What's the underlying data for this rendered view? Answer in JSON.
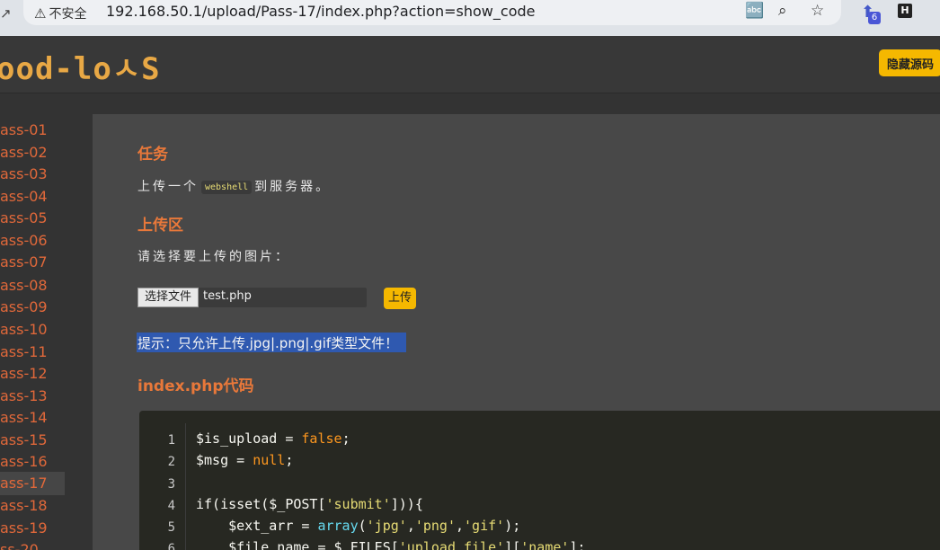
{
  "browser": {
    "insecure_label": "不安全",
    "url": "192.168.50.1/upload/Pass-17/index.php?action=show_code",
    "extension_badge": "6",
    "extension_letter": "H"
  },
  "header": {
    "logo": "ood-loㅅS",
    "hide_code_button": "隐藏源码"
  },
  "sidebar": {
    "items": [
      "ass-01",
      "ass-02",
      "ass-03",
      "ass-04",
      "ass-05",
      "ass-06",
      "ass-07",
      "ass-08",
      "ass-09",
      "ass-10",
      "ass-11",
      "ass-12",
      "ass-13",
      "ass-14",
      "ass-15",
      "ass-16",
      "ass-17",
      "ass-18",
      "ass-19",
      "ss-20"
    ],
    "active_item": "ass-17"
  },
  "main": {
    "task_heading": "任务",
    "task_text_before": "上传一个",
    "task_code": "webshell",
    "task_text_after": "到服务器。",
    "upload_heading": "上传区",
    "choose_prompt": "请选择要上传的图片：",
    "file_button": "选择文件",
    "file_name": "test.php",
    "upload_button": "上传",
    "hint": "提示：只允许上传.jpg|.png|.gif类型文件！",
    "code_heading": "index.php代码"
  },
  "code": {
    "line_numbers": [
      "1",
      "2",
      "3",
      "4",
      "5",
      "6"
    ],
    "l1_var": "$is_upload",
    "l1_op": " = ",
    "l1_kw": "false",
    "l1_end": ";",
    "l2_var": "$msg",
    "l2_op": " = ",
    "l2_kw": "null",
    "l2_end": ";",
    "l4_a": "if(isset(",
    "l4_var": "$_POST",
    "l4_b": "[",
    "l4_str": "'submit'",
    "l4_c": "])){",
    "l5_indent": "    ",
    "l5_var": "$ext_arr",
    "l5_op": " = ",
    "l5_fn": "array",
    "l5_a": "(",
    "l5_s1": "'jpg'",
    "l5_c1": ",",
    "l5_s2": "'png'",
    "l5_c2": ",",
    "l5_s3": "'gif'",
    "l5_end": ");",
    "l6_indent": "    ",
    "l6_var": "$file_name",
    "l6_op": " = ",
    "l6_var2": "$_FILES",
    "l6_b1": "[",
    "l6_s1": "'upload_file'",
    "l6_b2": "][",
    "l6_s2": "'name'",
    "l6_end": "];"
  },
  "colors": {
    "accent": "#f5b800",
    "heading": "#e8783a",
    "sidebar_link": "#e0683a",
    "hint_highlight": "#2f59b0"
  }
}
